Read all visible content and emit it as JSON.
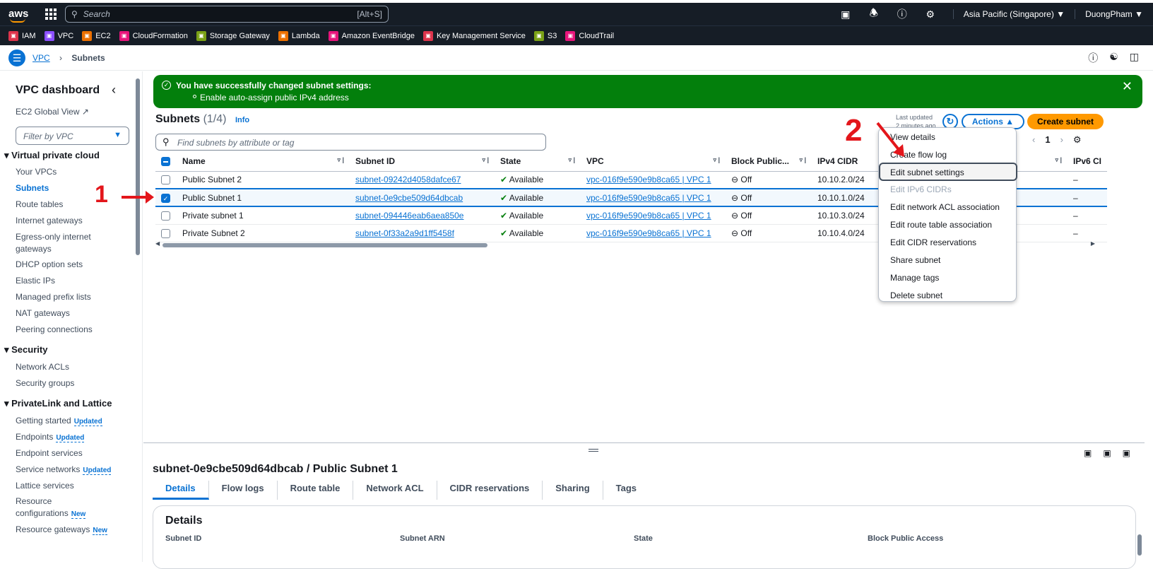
{
  "topbar": {
    "logo": "aws",
    "search_placeholder": "Search",
    "search_shortcut": "[Alt+S]",
    "icons": [
      "cloudshell-icon",
      "bell-icon",
      "help-icon",
      "gear-icon"
    ],
    "region": "Asia Pacific (Singapore) ▼",
    "user": "DuongPham ▼"
  },
  "favorites": [
    {
      "label": "IAM",
      "color": "#dd344c"
    },
    {
      "label": "VPC",
      "color": "#8c4fff"
    },
    {
      "label": "EC2",
      "color": "#ed7100"
    },
    {
      "label": "CloudFormation",
      "color": "#e7157b"
    },
    {
      "label": "Storage Gateway",
      "color": "#7aa116"
    },
    {
      "label": "Lambda",
      "color": "#ed7100"
    },
    {
      "label": "Amazon EventBridge",
      "color": "#e7157b"
    },
    {
      "label": "Key Management Service",
      "color": "#dd344c"
    },
    {
      "label": "S3",
      "color": "#7aa116"
    },
    {
      "label": "CloudTrail",
      "color": "#e7157b"
    }
  ],
  "breadcrumb": {
    "root": "VPC",
    "current": "Subnets"
  },
  "sidebar": {
    "title": "VPC dashboard",
    "ec2_global_view": "EC2 Global View",
    "filter_placeholder": "Filter by VPC",
    "sections": [
      {
        "title": "Virtual private cloud",
        "items": [
          "Your VPCs",
          "Subnets",
          "Route tables",
          "Internet gateways",
          "Egress-only internet gateways",
          "DHCP option sets",
          "Elastic IPs",
          "Managed prefix lists",
          "NAT gateways",
          "Peering connections"
        ]
      },
      {
        "title": "Security",
        "items": [
          "Network ACLs",
          "Security groups"
        ]
      },
      {
        "title": "PrivateLink and Lattice",
        "items": [
          "Getting started",
          "Endpoints",
          "Endpoint services",
          "Service networks",
          "Lattice services",
          "Resource configurations",
          "Resource gateways"
        ]
      }
    ],
    "badges": {
      "updated": "Updated",
      "new": "New"
    }
  },
  "flash": {
    "title": "You have successfully changed subnet settings:",
    "detail": "Enable auto-assign public IPv4 address"
  },
  "subnets_header": {
    "title": "Subnets",
    "count": "(1/4)",
    "info": "Info",
    "last_updated_1": "Last updated",
    "last_updated_2": "2 minutes ago",
    "actions": "Actions ▲",
    "create": "Create subnet",
    "find_placeholder": "Find subnets by attribute or tag",
    "page": "1"
  },
  "table": {
    "columns": [
      "Name",
      "Subnet ID",
      "State",
      "VPC",
      "Block Public...",
      "IPv4 CIDR",
      "IPv6 CI"
    ],
    "rows": [
      {
        "name": "Public Subnet 2",
        "id": "subnet-09242d4058dafce67",
        "state": "Available",
        "vpc": "vpc-016f9e590e9b8ca65 | VPC 1",
        "block": "Off",
        "cidr": "10.10.2.0/24",
        "ipv6": "–",
        "selected": false
      },
      {
        "name": "Public Subnet 1",
        "id": "subnet-0e9cbe509d64dbcab",
        "state": "Available",
        "vpc": "vpc-016f9e590e9b8ca65 | VPC 1",
        "block": "Off",
        "cidr": "10.10.1.0/24",
        "ipv6": "–",
        "selected": true
      },
      {
        "name": "Private subnet 1",
        "id": "subnet-094446eab6aea850e",
        "state": "Available",
        "vpc": "vpc-016f9e590e9b8ca65 | VPC 1",
        "block": "Off",
        "cidr": "10.10.3.0/24",
        "ipv6": "–",
        "selected": false
      },
      {
        "name": "Private Subnet 2",
        "id": "subnet-0f33a2a9d1ff5458f",
        "state": "Available",
        "vpc": "vpc-016f9e590e9b8ca65 | VPC 1",
        "block": "Off",
        "cidr": "10.10.4.0/24",
        "ipv6": "–",
        "selected": false
      }
    ]
  },
  "actions_menu": {
    "items": [
      "View details",
      "Create flow log",
      "Edit subnet settings",
      "Edit IPv6 CIDRs",
      "Edit network ACL association",
      "Edit route table association",
      "Edit CIDR reservations",
      "Share subnet",
      "Manage tags",
      "Delete subnet"
    ],
    "highlighted": "Edit subnet settings",
    "disabled": "Edit IPv6 CIDRs"
  },
  "annotations": {
    "step1": "1",
    "step2": "2"
  },
  "details_panel": {
    "title": "subnet-0e9cbe509d64dbcab / Public Subnet 1",
    "tabs": [
      "Details",
      "Flow logs",
      "Route table",
      "Network ACL",
      "CIDR reservations",
      "Sharing",
      "Tags"
    ],
    "card_title": "Details",
    "columns": [
      "Subnet ID",
      "Subnet ARN",
      "State",
      "Block Public Access"
    ]
  },
  "colors": {
    "accent": "#0972d3",
    "success": "#037f0c",
    "primary_button": "#ff9900",
    "annotation": "#e3161b",
    "nav": "#161d26"
  }
}
